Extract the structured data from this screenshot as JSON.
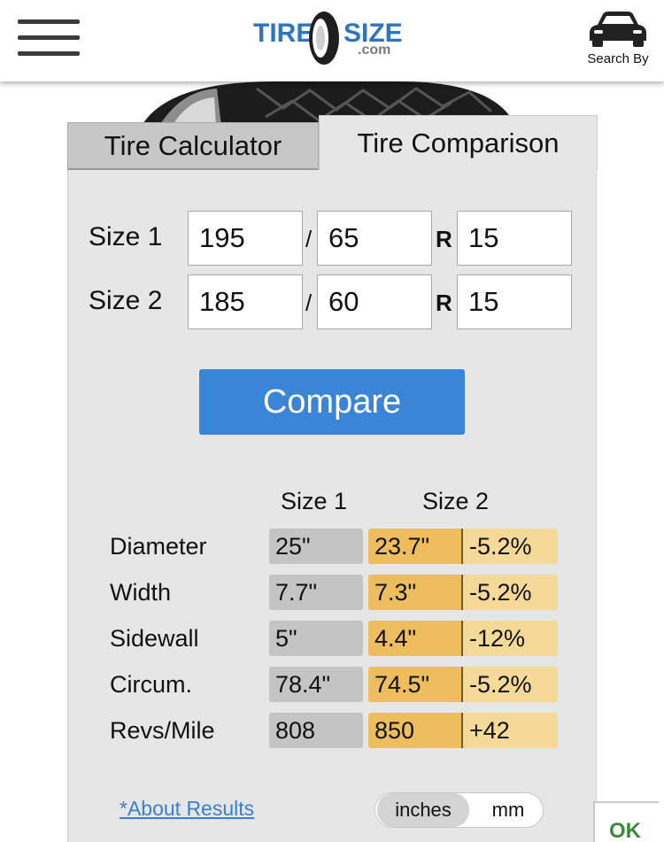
{
  "header": {
    "logo_tire": "TIRE",
    "logo_size": "SIZE",
    "logo_domain": ".com",
    "search_by_label": "Search By"
  },
  "tabs": [
    {
      "label": "Tire Calculator"
    },
    {
      "label": "Tire Comparison"
    }
  ],
  "form": {
    "size1": {
      "label": "Size 1",
      "width": "195",
      "ratio": "65",
      "rim": "15"
    },
    "size2": {
      "label": "Size 2",
      "width": "185",
      "ratio": "60",
      "rim": "15"
    },
    "slash": "/",
    "r": "R",
    "compare_label": "Compare"
  },
  "results": {
    "col1": "Size 1",
    "col2": "Size 2",
    "rows": [
      {
        "label": "Diameter",
        "size1": "25\"",
        "size2": "23.7\"",
        "diff": "-5.2%"
      },
      {
        "label": "Width",
        "size1": "7.7\"",
        "size2": "7.3\"",
        "diff": "-5.2%"
      },
      {
        "label": "Sidewall",
        "size1": "5\"",
        "size2": "4.4\"",
        "diff": "-12%"
      },
      {
        "label": "Circum.",
        "size1": "78.4\"",
        "size2": "74.5\"",
        "diff": "-5.2%"
      },
      {
        "label": "Revs/Mile",
        "size1": "808",
        "size2": "850",
        "diff": "+42"
      }
    ]
  },
  "footer": {
    "about_link": "*About Results",
    "unit_inches": "inches",
    "unit_mm": "mm",
    "selected_unit": "inches",
    "ok_label": "OK"
  },
  "colors": {
    "accent_blue": "#3b85d8",
    "size2_cell": "#eebd5d",
    "diff_cell": "#f5d999",
    "size1_cell": "#c4c4c4"
  }
}
